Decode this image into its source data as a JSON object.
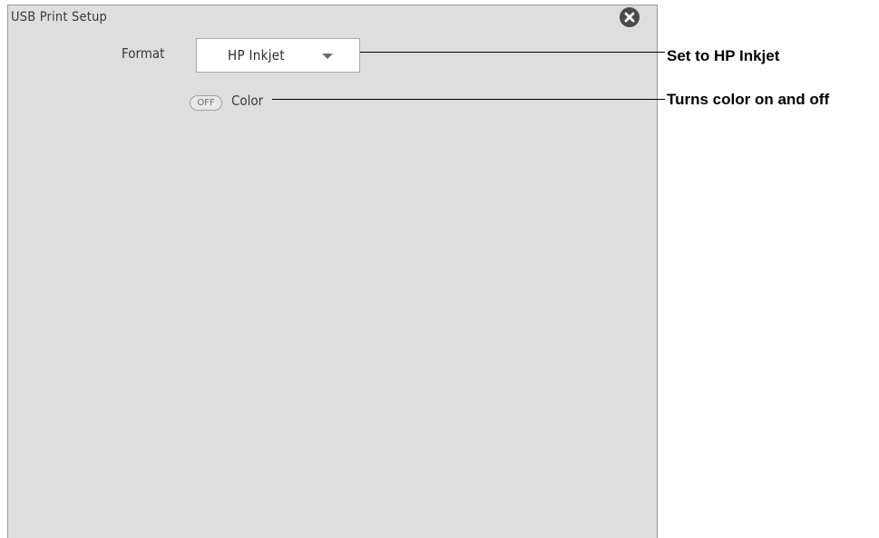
{
  "dialog": {
    "title": "USB Print Setup",
    "close_icon": "close-circle-icon"
  },
  "format": {
    "label": "Format",
    "value": "HP Inkjet",
    "arrow_icon": "dropdown-arrow-icon"
  },
  "color": {
    "toggle_state": "OFF",
    "label": "Color"
  },
  "callouts": {
    "format_note": "Set to HP Inkjet",
    "color_note": "Turns color on and off"
  }
}
